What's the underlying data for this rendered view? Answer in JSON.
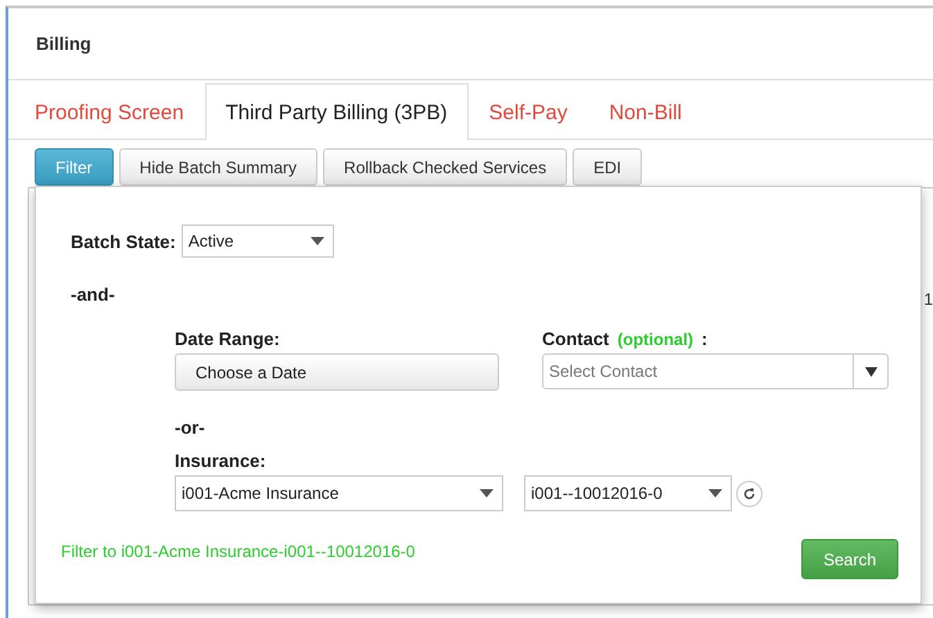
{
  "header": {
    "title": "Billing"
  },
  "tabs": [
    {
      "label": "Proofing Screen",
      "selected": false
    },
    {
      "label": "Third Party Billing (3PB)",
      "selected": true
    },
    {
      "label": "Self-Pay",
      "selected": false
    },
    {
      "label": "Non-Bill",
      "selected": false
    }
  ],
  "toolbar": [
    {
      "label": "Filter",
      "selected": true
    },
    {
      "label": "Hide Batch Summary",
      "selected": false
    },
    {
      "label": "Rollback Checked Services",
      "selected": false
    },
    {
      "label": "EDI",
      "selected": false
    }
  ],
  "background_fragment": "1",
  "filter_panel": {
    "batch_state": {
      "label": "Batch State:",
      "value": "Active"
    },
    "and_label": "-and-",
    "date_range": {
      "label": "Date Range:",
      "button": "Choose a Date"
    },
    "contact": {
      "label": "Contact",
      "optional": "(optional)",
      "colon": ":",
      "placeholder": "Select Contact"
    },
    "or_label": "-or-",
    "insurance": {
      "label": "Insurance:",
      "value": "i001-Acme Insurance",
      "batch": "i001--10012016-0"
    },
    "summary": "Filter to i001-Acme Insurance-i001--10012016-0",
    "search_button": "Search"
  }
}
